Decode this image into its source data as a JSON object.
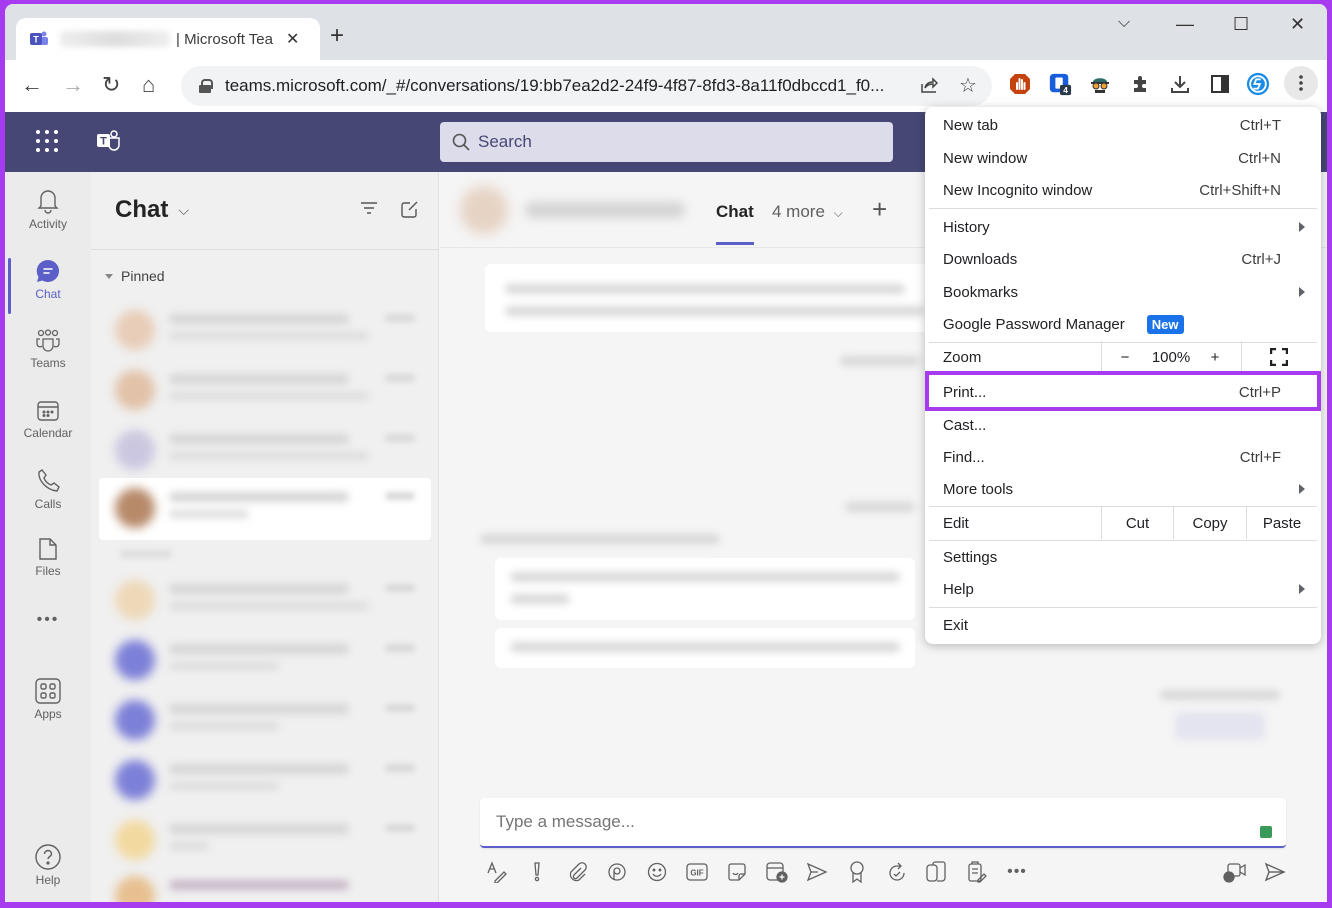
{
  "browser": {
    "tab": {
      "title": "| Microsoft Tea",
      "close_icon": "close-icon"
    },
    "new_tab_icon": "+",
    "window_controls": {
      "tab_search": "⌄",
      "minimize": "—",
      "maximize": "☐",
      "close": "✕"
    },
    "nav": {
      "back": "←",
      "forward": "→",
      "reload": "↻",
      "home": "⌂"
    },
    "url": "teams.microsoft.com/_#/conversations/19:bb7ea2d2-24f9-4f87-8fd3-8a11f0dbccd1_f0...",
    "extensions": [
      {
        "name": "ublock-origin",
        "color": "#c4420c"
      },
      {
        "name": "bitwarden-like",
        "color": "#175ddc",
        "badge": "4"
      },
      {
        "name": "incognito-glasses",
        "color": "#444444"
      },
      {
        "name": "extensions-puzzle",
        "color": "#444444"
      },
      {
        "name": "downloads",
        "color": "#444444"
      },
      {
        "name": "side-panel",
        "color": "#444444"
      },
      {
        "name": "profile-s",
        "color": "#1a8ce8"
      }
    ]
  },
  "teams": {
    "search_placeholder": "Search",
    "rail": [
      {
        "label": "Activity",
        "icon": "bell-icon"
      },
      {
        "label": "Chat",
        "icon": "chat-icon",
        "active": true
      },
      {
        "label": "Teams",
        "icon": "teams-icon"
      },
      {
        "label": "Calendar",
        "icon": "calendar-icon"
      },
      {
        "label": "Calls",
        "icon": "phone-icon"
      },
      {
        "label": "Files",
        "icon": "file-icon"
      },
      {
        "label": "•••",
        "icon": "more-icon"
      },
      {
        "label": "Apps",
        "icon": "apps-icon"
      },
      {
        "label": "Help",
        "icon": "help-icon"
      }
    ],
    "chatlist": {
      "title": "Chat",
      "section": "Pinned"
    },
    "conversation": {
      "tabs": {
        "chat": "Chat",
        "more": "4 more"
      },
      "composer_placeholder": "Type a message..."
    }
  },
  "chrome_menu": {
    "items": {
      "new_tab": {
        "label": "New tab",
        "shortcut": "Ctrl+T"
      },
      "new_window": {
        "label": "New window",
        "shortcut": "Ctrl+N"
      },
      "new_incognito": {
        "label": "New Incognito window",
        "shortcut": "Ctrl+Shift+N"
      },
      "history": {
        "label": "History"
      },
      "downloads": {
        "label": "Downloads",
        "shortcut": "Ctrl+J"
      },
      "bookmarks": {
        "label": "Bookmarks"
      },
      "password_manager": {
        "label": "Google Password Manager",
        "badge": "New"
      },
      "zoom": {
        "label": "Zoom",
        "minus": "−",
        "value": "100%",
        "plus": "+"
      },
      "print": {
        "label": "Print...",
        "shortcut": "Ctrl+P"
      },
      "cast": {
        "label": "Cast..."
      },
      "find": {
        "label": "Find...",
        "shortcut": "Ctrl+F"
      },
      "more_tools": {
        "label": "More tools"
      },
      "edit": {
        "label": "Edit",
        "cut": "Cut",
        "copy": "Copy",
        "paste": "Paste"
      },
      "settings": {
        "label": "Settings"
      },
      "help": {
        "label": "Help"
      },
      "exit": {
        "label": "Exit"
      }
    },
    "highlight_color": "#a63bf0"
  },
  "colors": {
    "teams_header": "#464775",
    "teams_accent": "#5b5fc7",
    "frame_highlight": "#a63bf0"
  }
}
